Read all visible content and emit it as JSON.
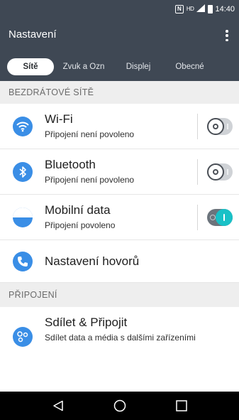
{
  "status_bar": {
    "time": "14:40",
    "nfc_icon": "N",
    "hd_label": "HD"
  },
  "app_bar": {
    "title": "Nastavení",
    "overflow_icon": "more-vert-icon"
  },
  "tabs": [
    {
      "label": "Sítě",
      "active": true
    },
    {
      "label": "Zvuk a Ozn",
      "active": false
    },
    {
      "label": "Displej",
      "active": false
    },
    {
      "label": "Obecné",
      "active": false
    }
  ],
  "sections": {
    "wireless": {
      "header": "BEZDRÁTOVÉ SÍTĚ",
      "items": [
        {
          "title": "Wi-Fi",
          "subtitle": "Připojení není povoleno",
          "icon": "wifi-icon",
          "icon_color": "#3a8ee6",
          "toggle": "off"
        },
        {
          "title": "Bluetooth",
          "subtitle": "Připojení není povoleno",
          "icon": "bluetooth-icon",
          "icon_color": "#3a8ee6",
          "toggle": "off"
        },
        {
          "title": "Mobilní data",
          "subtitle": "Připojení povoleno",
          "icon": "mobile-data-icon",
          "icon_color": "#3a8ee6",
          "toggle": "on"
        },
        {
          "title": "Nastavení hovorů",
          "icon": "phone-icon",
          "icon_color": "#3a8ee6"
        }
      ]
    },
    "connection": {
      "header": "PŘIPOJENÍ",
      "items": [
        {
          "title": "Sdílet & Připojit",
          "subtitle": "Sdílet data a média s dalšími zařízeními",
          "icon": "share-connect-icon",
          "icon_color": "#3a8ee6"
        }
      ]
    }
  },
  "nav_bar": {
    "back_icon": "back-triangle-icon",
    "home_icon": "home-circle-icon",
    "recents_icon": "recents-square-icon"
  },
  "colors": {
    "header_bg": "#3f4854",
    "accent": "#19c1c7",
    "icon_blue": "#3a8ee6"
  }
}
